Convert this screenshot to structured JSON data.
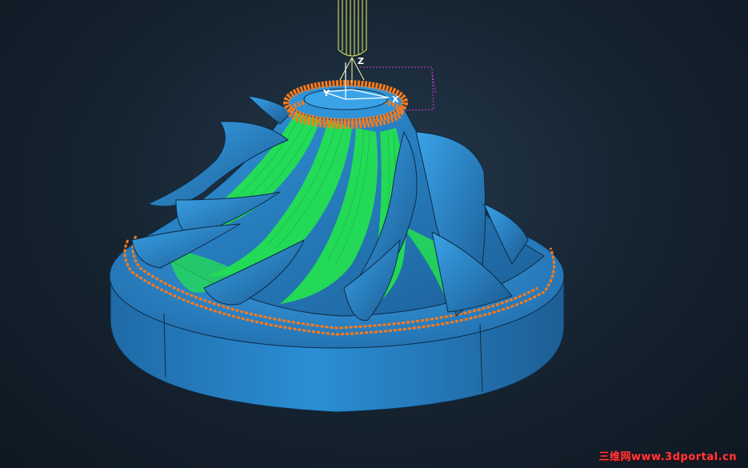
{
  "viewport": {
    "background": "#15222f",
    "part_color": "#2a86c8",
    "toolpath_green": "#23e84a",
    "toolpath_orange": "#ff7a18",
    "tool_color": "#e8f25a",
    "bbox_color": "#d63bd0"
  },
  "axes": {
    "x_label": "X",
    "y_label": "Y",
    "z_label": "Z"
  },
  "watermark": {
    "text": "三维网www.3dportal.cn"
  }
}
